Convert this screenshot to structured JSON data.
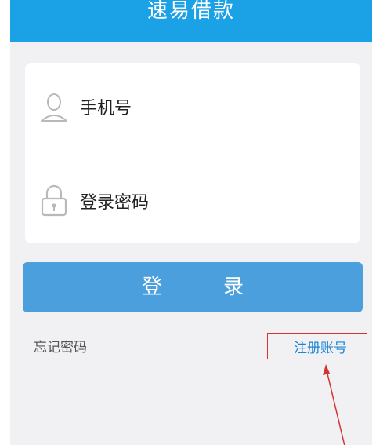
{
  "app": {
    "title": "速易借款"
  },
  "form": {
    "phone_label": "手机号",
    "password_label": "登录密码"
  },
  "actions": {
    "login_label": "登　录",
    "forgot_password_label": "忘记密码",
    "register_label": "注册账号"
  },
  "icons": {
    "phone_field": "user-icon",
    "password_field": "lock-icon"
  },
  "colors": {
    "header": "#1ba1e6",
    "login_button": "#4a9fdc",
    "register_link": "#1c86d6",
    "annotation": "#d23333"
  }
}
